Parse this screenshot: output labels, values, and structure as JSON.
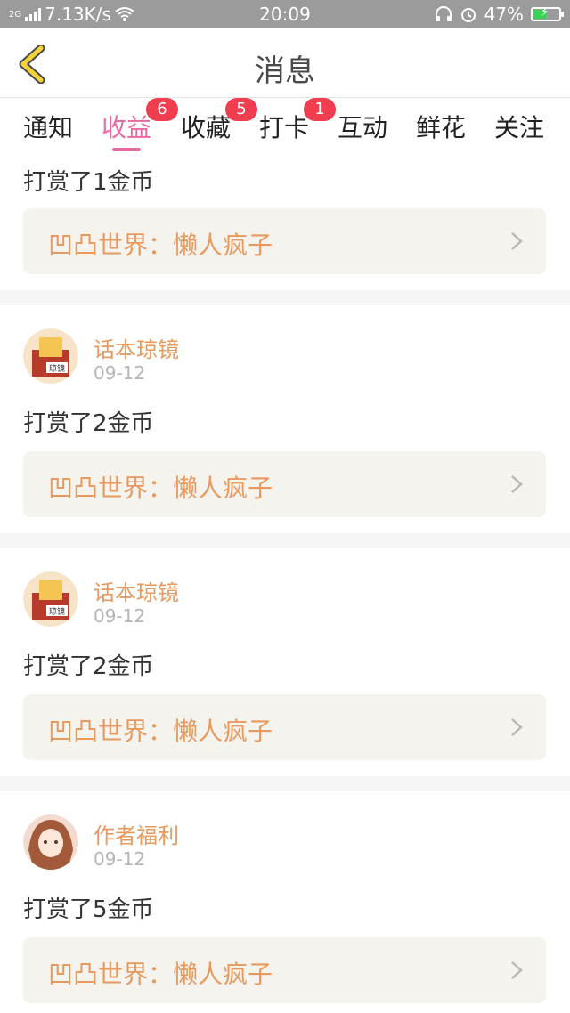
{
  "status_bar": {
    "network": "2G",
    "speed": "7.13K/s",
    "time": "20:09",
    "battery": "47%"
  },
  "header": {
    "title": "消息",
    "back_icon": "back-chevron-icon",
    "accent": "#f5d23a"
  },
  "tabs": [
    {
      "label": "通知",
      "badge": null,
      "active": false
    },
    {
      "label": "收益",
      "badge": "6",
      "active": true
    },
    {
      "label": "收藏",
      "badge": "5",
      "active": false
    },
    {
      "label": "打卡",
      "badge": "1",
      "active": false
    },
    {
      "label": "互动",
      "badge": null,
      "active": false
    },
    {
      "label": "鲜花",
      "badge": null,
      "active": false
    },
    {
      "label": "关注",
      "badge": null,
      "active": false
    }
  ],
  "colors": {
    "active_tab": "#e86aa3",
    "badge": "#f03d4f",
    "name": "#e69a5f",
    "book_label": "#e69a5f",
    "book_bg": "#f5f3ee"
  },
  "messages": [
    {
      "name": null,
      "date": null,
      "reward": "打赏了1金币",
      "book": "凹凸世界：懒人疯子"
    },
    {
      "name": "话本琼镜",
      "date": "09-12",
      "reward": "打赏了2金币",
      "book": "凹凸世界：懒人疯子"
    },
    {
      "name": "话本琼镜",
      "date": "09-12",
      "reward": "打赏了2金币",
      "book": "凹凸世界：懒人疯子"
    },
    {
      "name": "作者福利",
      "date": "09-12",
      "reward": "打赏了5金币",
      "book": "凹凸世界：懒人疯子"
    }
  ]
}
